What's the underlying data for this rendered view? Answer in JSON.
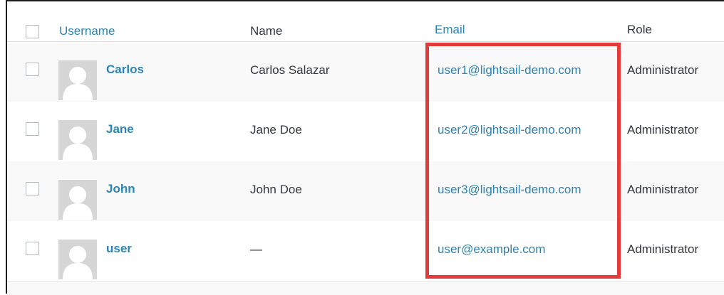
{
  "table": {
    "columns": {
      "username": "Username",
      "name": "Name",
      "email": "Email",
      "role": "Role"
    },
    "rows": [
      {
        "username": "Carlos",
        "name": "Carlos Salazar",
        "email": "user1@lightsail-demo.com",
        "role": "Administrator"
      },
      {
        "username": "Jane",
        "name": "Jane Doe",
        "email": "user2@lightsail-demo.com",
        "role": "Administrator"
      },
      {
        "username": "John",
        "name": "John Doe",
        "email": "user3@lightsail-demo.com",
        "role": "Administrator"
      },
      {
        "username": "user",
        "name": "—",
        "email": "user@example.com",
        "role": "Administrator"
      }
    ]
  },
  "colors": {
    "link": "#2a84b5",
    "text": "#32373c",
    "highlight": "#e33a3a",
    "row_alt": "#f9f9f9"
  },
  "icons": {
    "avatar": "default-avatar-icon",
    "checkbox": "checkbox-icon"
  }
}
